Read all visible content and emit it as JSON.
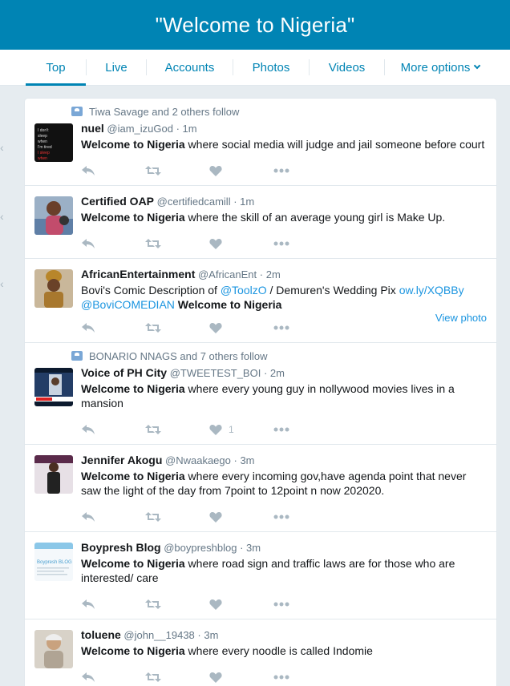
{
  "header": {
    "title": "\"Welcome to Nigeria\""
  },
  "tabs": [
    {
      "label": "Top",
      "active": true
    },
    {
      "label": "Live"
    },
    {
      "label": "Accounts"
    },
    {
      "label": "Photos"
    },
    {
      "label": "Videos"
    },
    {
      "label": "More options"
    }
  ],
  "tweets": [
    {
      "context": "Tiwa Savage and 2 others follow",
      "name": "nuel",
      "handle": "@iam_izuGod",
      "time": "1m",
      "bold": "Welcome to Nigeria",
      "text": " where social media will judge and jail someone before court",
      "likes": ""
    },
    {
      "context": "",
      "name": "Certified OAP",
      "handle": "@certifiedcamill",
      "time": "1m",
      "bold": "Welcome to Nigeria",
      "text": " where the skill of an average young girl is Make Up.",
      "likes": ""
    },
    {
      "context": "",
      "name": "AfricanEntertainment",
      "handle": "@AfricanEnt",
      "time": "2m",
      "pre": "Bovi's Comic Description of ",
      "link1": "@ToolzO",
      "mid": " / Demuren's Wedding Pix ",
      "link2": "ow.ly/XQBBy",
      "link3": "@BoviCOMEDIAN",
      "bold": "Welcome to Nigeria",
      "view_photo": "View photo",
      "likes": ""
    },
    {
      "context": "BONARIO NNAGS and 7 others follow",
      "name": "Voice of PH City",
      "handle": "@TWEETEST_BOI",
      "time": "2m",
      "bold": "Welcome to Nigeria",
      "text": " where every young guy in nollywood movies lives in a mansion",
      "likes": "1"
    },
    {
      "context": "",
      "name": "Jennifer Akogu",
      "handle": "@Nwaakaego",
      "time": "3m",
      "bold": "Welcome to Nigeria",
      "text": " where every incoming gov,have agenda point that never saw the light of the day from 7point to 12point n now 202020.",
      "likes": ""
    },
    {
      "context": "",
      "name": "Boypresh Blog",
      "handle": "@boypreshblog",
      "time": "3m",
      "bold": "Welcome to Nigeria",
      "text": " where road sign and traffic laws are for those who are interested/ care",
      "likes": "",
      "avatar_text": "Boypresh BLOG"
    },
    {
      "context": "",
      "name": "toluene",
      "handle": "@john__19438",
      "time": "3m",
      "bold": "Welcome to Nigeria",
      "text": " where every noodle is called Indomie",
      "likes": ""
    }
  ],
  "colors": {
    "header": "#0084b4",
    "link": "#1b95e0",
    "muted": "#657786",
    "icon": "#aab8c2"
  }
}
